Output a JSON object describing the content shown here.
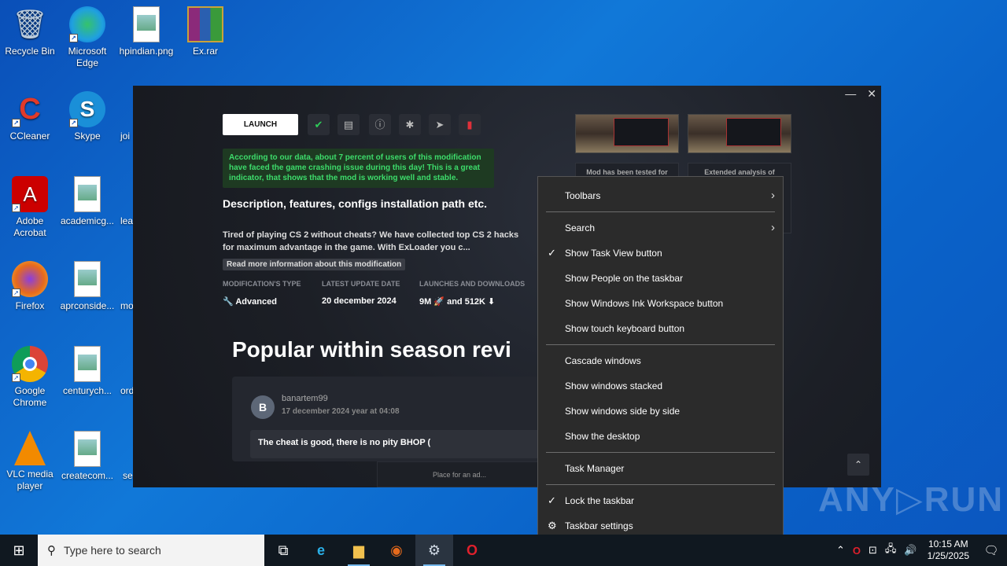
{
  "desktop": {
    "icons": [
      {
        "label": "Recycle Bin",
        "glyph": "🗑",
        "color": "#bcd"
      },
      {
        "label": "Microsoft Edge",
        "glyph": "e",
        "color": "#1fa0e0"
      },
      {
        "label": "hpindian.png",
        "glyph": "▭",
        "color": "#dde"
      },
      {
        "label": "Ex.rar",
        "glyph": "▤",
        "color": "#c33"
      },
      {
        "label": "CCleaner",
        "glyph": "C",
        "color": "#d33"
      },
      {
        "label": "Skype",
        "glyph": "S",
        "color": "#1a8fd8"
      },
      {
        "label": "Adobe Acrobat",
        "glyph": "A",
        "color": "#c00"
      },
      {
        "label": "academicg...",
        "glyph": "▭",
        "color": "#dde"
      },
      {
        "label": "Firefox",
        "glyph": "◉",
        "color": "#e66a1c"
      },
      {
        "label": "aprconside...",
        "glyph": "▭",
        "color": "#dde"
      },
      {
        "label": "Google Chrome",
        "glyph": "◉",
        "color": "#2a8f3a"
      },
      {
        "label": "centurych...",
        "glyph": "▭",
        "color": "#dde"
      },
      {
        "label": "VLC media player",
        "glyph": "▲",
        "color": "#f28a00"
      },
      {
        "label": "createcom...",
        "glyph": "▭",
        "color": "#dde"
      }
    ],
    "partial_labels": [
      "joi",
      "lea",
      "mo",
      "ord",
      "se"
    ]
  },
  "app": {
    "launch_label": "LAUNCH",
    "tool_icons": [
      "✔",
      "▤",
      "ⓘ",
      "✱",
      "➤",
      "▮"
    ],
    "notice": "According to our data, about 7 percent of users of this modification have faced the game crashing issue during this day! This is a great indicator, that shows that the mod is working well and stable.",
    "heading": "Description, features, configs installation path etc.",
    "description": "Tired of playing CS 2 without cheats? We have collected top CS 2 hacks for maximum advantage in the game. With ExLoader you c...",
    "read_more": "Read more information about this modification",
    "meta": {
      "type_h": "MODIFICATION'S TYPE",
      "type_v": "Advanced",
      "date_h": "LATEST UPDATE DATE",
      "date_v": "20 december 2024",
      "launch_h": "LAUNCHES AND DOWNLOADS",
      "launch_v": "9M 🚀 and 512K ⬇"
    },
    "popular_heading": "Popular within season revi",
    "review": {
      "avatar": "B",
      "user": "banartem99",
      "date": "17 december 2024 year at 04:08",
      "text": "The cheat is good, there is no pity BHOP ("
    },
    "card1": "Mod has been tested for",
    "card2": "Extended analysis of",
    "ad": "Place for an ad...",
    "window_controls": {
      "minimize": "—",
      "close": "✕"
    },
    "up_button": "⌃"
  },
  "context_menu": {
    "items": [
      {
        "label": "Toolbars",
        "arrow": "›",
        "check": ""
      },
      {
        "label": "Search",
        "arrow": "›",
        "check": ""
      },
      {
        "label": "Show Task View button",
        "arrow": "",
        "check": "✓"
      },
      {
        "label": "Show People on the taskbar",
        "arrow": "",
        "check": ""
      },
      {
        "label": "Show Windows Ink Workspace button",
        "arrow": "",
        "check": ""
      },
      {
        "label": "Show touch keyboard button",
        "arrow": "",
        "check": ""
      },
      {
        "label": "Cascade windows",
        "arrow": "",
        "check": ""
      },
      {
        "label": "Show windows stacked",
        "arrow": "",
        "check": ""
      },
      {
        "label": "Show windows side by side",
        "arrow": "",
        "check": ""
      },
      {
        "label": "Show the desktop",
        "arrow": "",
        "check": ""
      },
      {
        "label": "Task Manager",
        "arrow": "",
        "check": ""
      },
      {
        "label": "Lock the taskbar",
        "arrow": "",
        "check": "✓"
      },
      {
        "label": "Taskbar settings",
        "arrow": "",
        "check": "⚙"
      }
    ]
  },
  "watermark": "ANY▷RUN",
  "taskbar": {
    "start_glyph": "⊞",
    "search_placeholder": "Type here to search",
    "search_glyph": "⚲",
    "apps": [
      {
        "name": "task-view",
        "glyph": "⧉",
        "color": "#fff"
      },
      {
        "name": "edge",
        "glyph": "e",
        "color": "#2ab0e8"
      },
      {
        "name": "file-explorer",
        "glyph": "▆",
        "color": "#f2c14e"
      },
      {
        "name": "firefox",
        "glyph": "◉",
        "color": "#e66a1c"
      },
      {
        "name": "exloader",
        "glyph": "⚙",
        "color": "#cfd8e3"
      },
      {
        "name": "opera",
        "glyph": "O",
        "color": "#e0202c"
      }
    ],
    "tray_icons": [
      "⌃",
      "O",
      "⊡",
      "🖧",
      "🔊"
    ],
    "time": "10:15 AM",
    "date": "1/25/2025",
    "notification_glyph": "🗨"
  }
}
